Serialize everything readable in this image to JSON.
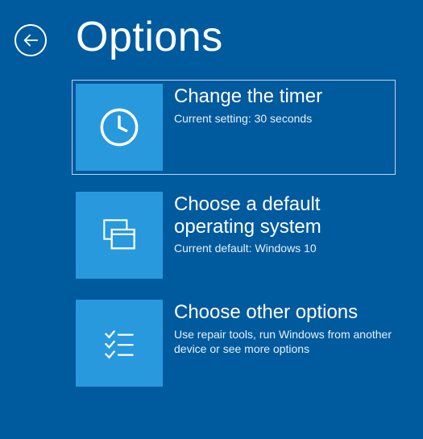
{
  "page": {
    "title": "Options"
  },
  "tiles": [
    {
      "title": "Change the timer",
      "subtitle": "Current setting: 30 seconds",
      "icon": "clock-icon",
      "selected": true
    },
    {
      "title": "Choose a default operating system",
      "subtitle": "Current default: Windows 10",
      "icon": "windows-icon",
      "selected": false
    },
    {
      "title": "Choose other options",
      "subtitle": "Use repair tools, run Windows from another device or see more options",
      "icon": "checklist-icon",
      "selected": false
    }
  ],
  "colors": {
    "background": "#005A9E",
    "tile": "#2899DC",
    "text": "#FFFFFF"
  }
}
